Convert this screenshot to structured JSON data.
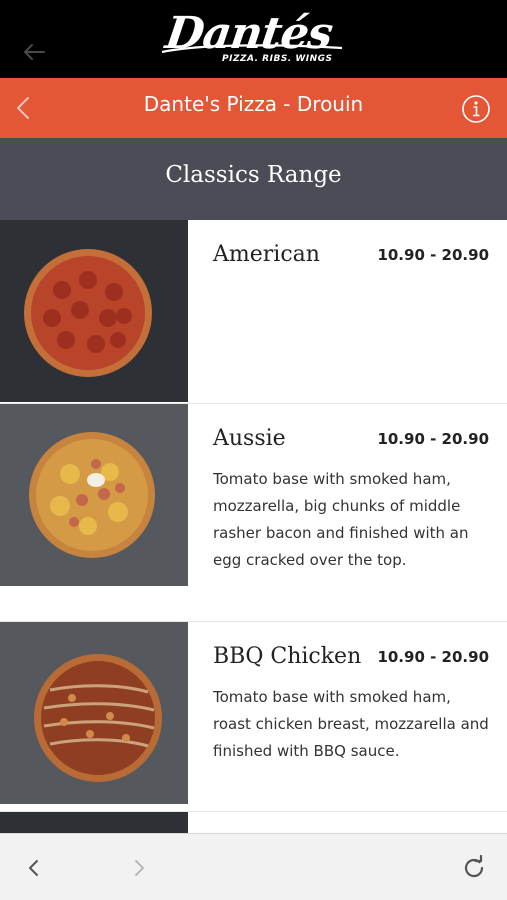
{
  "brand": {
    "logo_text": "Dantés",
    "tagline": "PIZZA. RIBS. WINGS"
  },
  "header": {
    "title": "Dante's Pizza - Drouin"
  },
  "section": {
    "title": "Classics Range"
  },
  "menu": {
    "items": [
      {
        "name": "American",
        "price": "10.90 - 20.90",
        "description": ""
      },
      {
        "name": "Aussie",
        "price": "10.90 - 20.90",
        "description": "Tomato base with smoked ham, mozzarella, big chunks of middle rasher bacon and finished with an egg cracked over the top."
      },
      {
        "name": "BBQ Chicken",
        "price": "10.90 - 20.90",
        "description": "Tomato base with smoked ham, roast chicken breast, mozzarella and finished with BBQ sauce."
      }
    ]
  },
  "icons": {
    "brand_back": "arrow-left-icon",
    "header_back": "chevron-left-icon",
    "info": "info-icon",
    "toolbar_back": "chevron-left-icon",
    "toolbar_forward": "chevron-right-icon",
    "reload": "reload-icon"
  },
  "colors": {
    "brand_bar": "#000000",
    "header": "#e35737",
    "section_band": "#4b4c56",
    "toolbar": "#f2f2f3"
  }
}
